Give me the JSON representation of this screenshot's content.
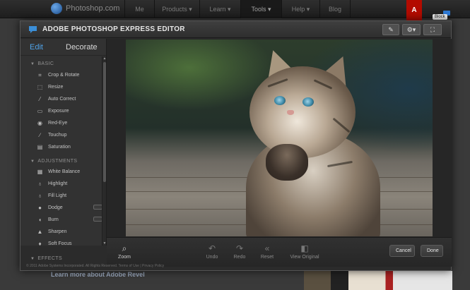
{
  "site": {
    "logo_text": "Photoshop.com",
    "nav": [
      "Me",
      "Products ▾",
      "Learn ▾",
      "Tools ▾",
      "Help ▾",
      "Blog"
    ],
    "adobe_badge": "A",
    "block_tag": "Block",
    "bg_link": "Learn more about Adobe Revel"
  },
  "editor": {
    "title": "ADOBE PHOTOSHOP EXPRESS EDITOR",
    "toolbar_icons": [
      "share-icon",
      "gear-icon",
      "fullscreen-icon"
    ],
    "tabs": {
      "edit": "Edit",
      "decorate": "Decorate"
    },
    "sections": {
      "basic": "BASIC",
      "adjustments": "ADJUSTMENTS",
      "effects": "EFFECTS"
    },
    "basic_tools": [
      {
        "label": "Crop & Rotate",
        "icon": "crop-icon"
      },
      {
        "label": "Resize",
        "icon": "resize-icon"
      },
      {
        "label": "Auto Correct",
        "icon": "wand-icon"
      },
      {
        "label": "Exposure",
        "icon": "exposure-icon"
      },
      {
        "label": "Red-Eye",
        "icon": "eye-icon"
      },
      {
        "label": "Touchup",
        "icon": "brush-icon"
      },
      {
        "label": "Saturation",
        "icon": "saturation-icon"
      }
    ],
    "adjust_tools": [
      {
        "label": "White Balance",
        "icon": "thermometer-icon"
      },
      {
        "label": "Highlight",
        "icon": "bulb-icon"
      },
      {
        "label": "Fill Light",
        "icon": "fill-light-icon"
      },
      {
        "label": "Dodge",
        "icon": "dodge-icon"
      },
      {
        "label": "Burn",
        "icon": "burn-icon"
      },
      {
        "label": "Sharpen",
        "icon": "sharpen-icon"
      },
      {
        "label": "Soft Focus",
        "icon": "soft-focus-icon"
      }
    ],
    "bottom": {
      "zoom": "Zoom",
      "undo": "Undo",
      "redo": "Redo",
      "reset": "Reset",
      "view_original": "View Original",
      "cancel": "Cancel",
      "done": "Done"
    },
    "footer": "© 2011 Adobe Systems Incorporated. All Rights Reserved.   Terms of Use  |  Privacy Policy"
  }
}
